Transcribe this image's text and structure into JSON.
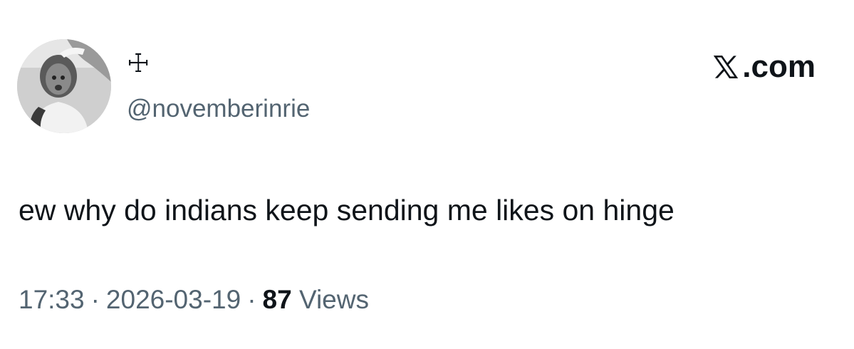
{
  "user": {
    "display_name": "☩",
    "handle": "@novemberinrie",
    "avatar_icon": "profile-photo"
  },
  "brand": {
    "suffix": ".com",
    "logo_icon": "x-logo-icon"
  },
  "tweet": {
    "text": "ew why do indians keep sending me likes on hinge"
  },
  "meta": {
    "time": "17:33",
    "date": "2026-03-19",
    "separator": "·",
    "views_count": "87",
    "views_label": "Views"
  },
  "colors": {
    "text_primary": "#0f1419",
    "text_secondary": "#536471",
    "background": "#ffffff"
  }
}
